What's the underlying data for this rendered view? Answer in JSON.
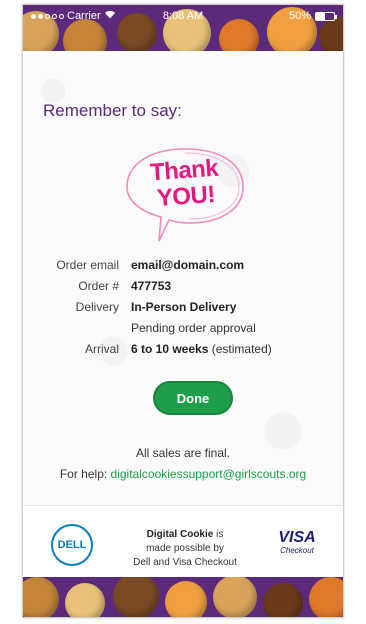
{
  "status_bar": {
    "carrier": "Carrier",
    "time": "8:08 AM",
    "battery_text": "50%",
    "battery_level": 0.5
  },
  "header": {
    "remember": "Remember to say:"
  },
  "thank_you": {
    "line1": "Thank",
    "line2": "YOU!"
  },
  "order": {
    "rows": [
      {
        "label": "Order email",
        "value": "email@domain.com"
      },
      {
        "label": "Order #",
        "value": "477753"
      },
      {
        "label": "Delivery",
        "value": "In-Person Delivery"
      },
      {
        "label": "",
        "value": "Pending order approval"
      },
      {
        "label": "Arrival",
        "value": "6 to 10 weeks",
        "suffix": " (estimated)"
      }
    ]
  },
  "done_label": "Done",
  "final_note": "All sales are final.",
  "help": {
    "prefix": "For help: ",
    "email": "digitalcookiessupport@girlscouts.org"
  },
  "footer": {
    "dell_logo": "DELL",
    "brand": "Digital Cookie",
    "line1_suffix": " is",
    "line2": "made possible by",
    "line3": "Dell and Visa Checkout",
    "visa_word": "VISA",
    "visa_sub": "Checkout"
  },
  "colors": {
    "accent_purple": "#5b2a7a",
    "thank_pink": "#e6177f",
    "done_green": "#1e9e4a",
    "dell_blue": "#0a7cc0",
    "visa_navy": "#1a1f71"
  },
  "icons": [
    "signal-dots-icon",
    "wifi-icon",
    "battery-icon",
    "speech-bubble-icon",
    "dell-logo-icon",
    "visa-checkout-logo-icon"
  ]
}
